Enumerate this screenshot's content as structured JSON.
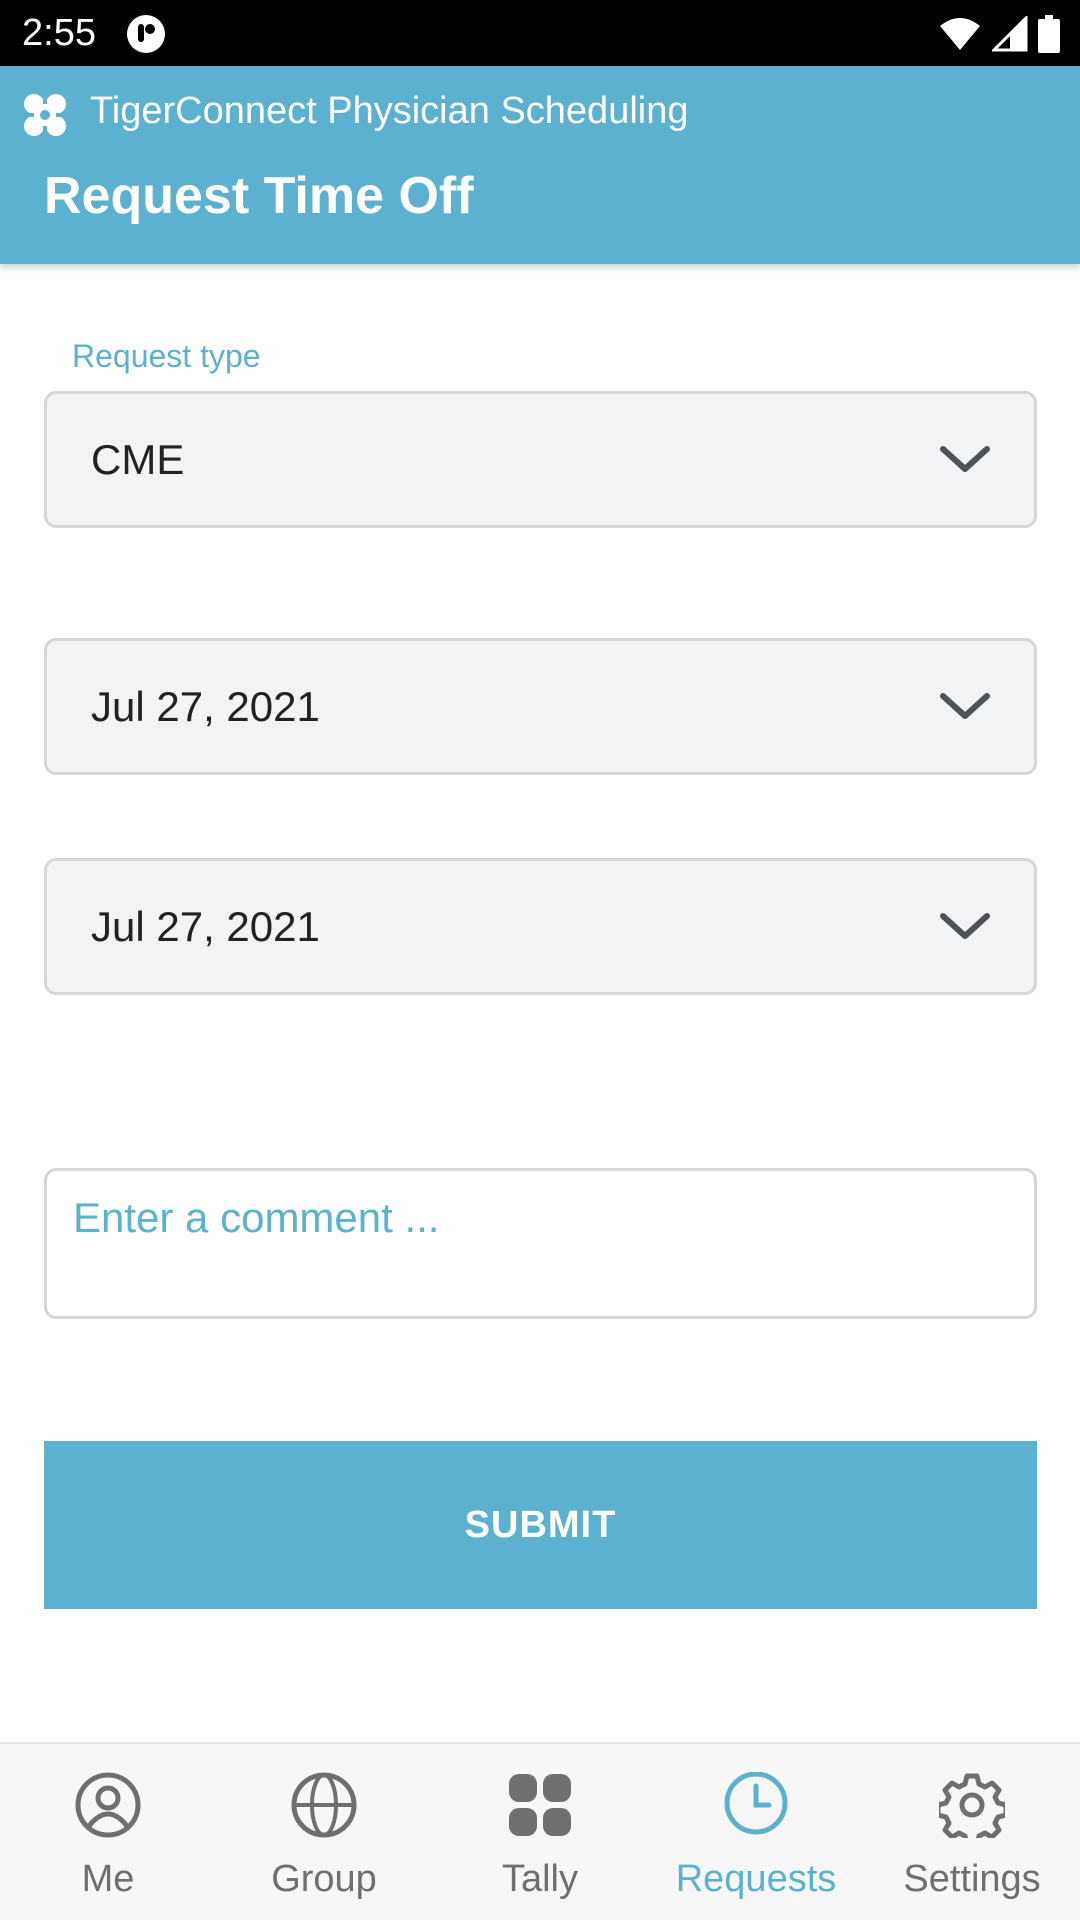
{
  "status_bar": {
    "time": "2:55"
  },
  "app_bar": {
    "app_name": "TigerConnect Physician Scheduling",
    "title": "Request Time Off"
  },
  "form": {
    "request_type_label": "Request type",
    "request_type_value": "CME",
    "start_date": "Jul 27, 2021",
    "end_date": "Jul 27, 2021",
    "comment_placeholder": "Enter a comment ...",
    "submit_label": "SUBMIT"
  },
  "nav": {
    "items": [
      {
        "label": "Me",
        "icon": "person-icon",
        "active": false
      },
      {
        "label": "Group",
        "icon": "globe-icon",
        "active": false
      },
      {
        "label": "Tally",
        "icon": "grid-icon",
        "active": false
      },
      {
        "label": "Requests",
        "icon": "clock-icon",
        "active": true
      },
      {
        "label": "Settings",
        "icon": "gear-icon",
        "active": false
      }
    ]
  },
  "colors": {
    "accent": "#5bb1cf",
    "field_bg": "#f2f3f5",
    "field_border": "#d4d6d9",
    "nav_inactive": "#6f6f6f"
  }
}
